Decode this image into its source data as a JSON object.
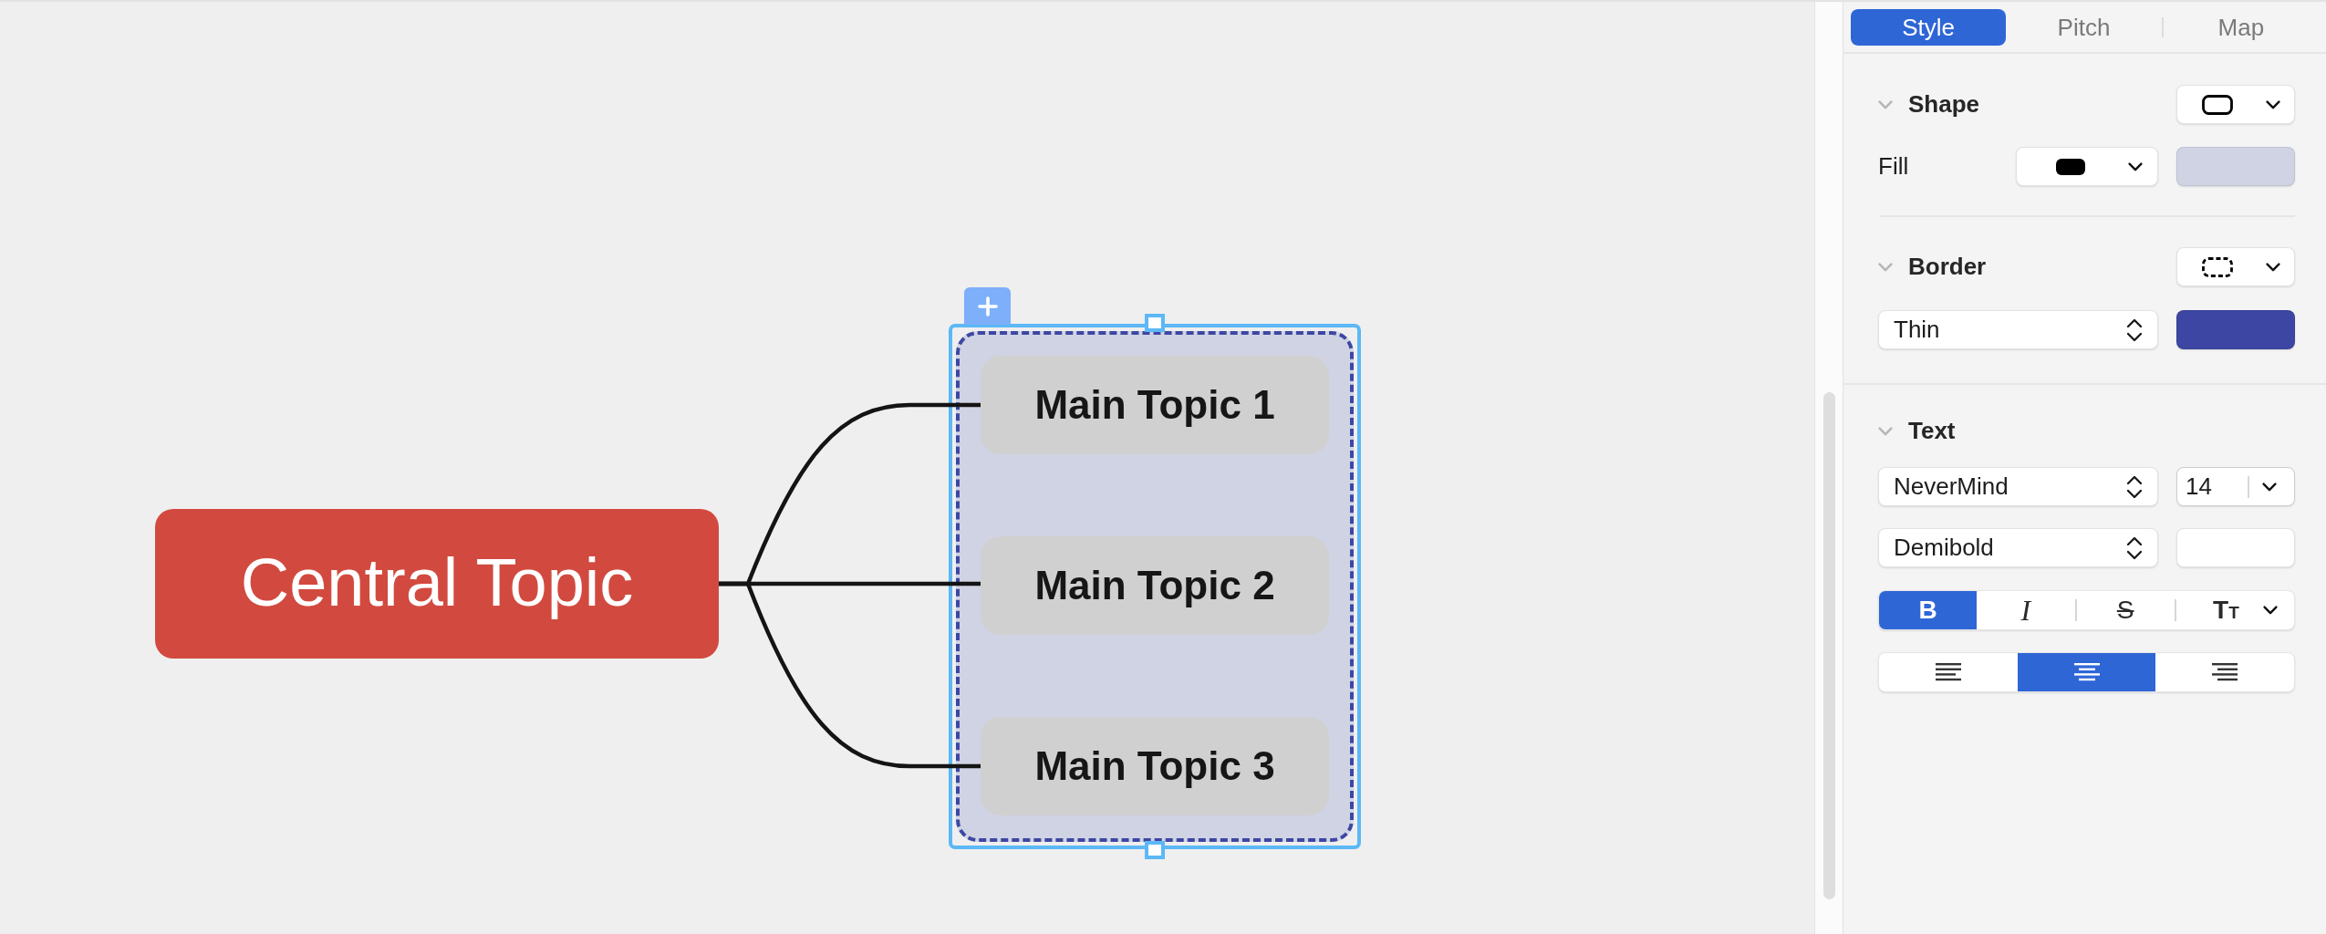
{
  "canvas": {
    "central_topic": "Central Topic",
    "boundary": {
      "selected": true,
      "topics": [
        "Main Topic 1",
        "Main Topic 2",
        "Main Topic 3"
      ]
    }
  },
  "panel": {
    "tabs": [
      {
        "label": "Style",
        "selected": true
      },
      {
        "label": "Pitch",
        "selected": false
      },
      {
        "label": "Map",
        "selected": false
      }
    ],
    "shape": {
      "title": "Shape",
      "expanded": true,
      "fill": {
        "label": "Fill",
        "color": "#d0d3e3"
      }
    },
    "border": {
      "title": "Border",
      "expanded": true,
      "width": "Thin",
      "color": "#3d47a3"
    },
    "text": {
      "title": "Text",
      "expanded": true,
      "font": "NeverMind",
      "size": "14",
      "weight": "Demibold",
      "styles": [
        {
          "kind": "bold",
          "label": "B",
          "selected": true
        },
        {
          "kind": "italic",
          "label": "I",
          "selected": false
        },
        {
          "kind": "strike",
          "label": "S",
          "selected": false
        },
        {
          "kind": "case",
          "label": "TT",
          "selected": false
        }
      ],
      "alignment": [
        {
          "kind": "left",
          "selected": false
        },
        {
          "kind": "center",
          "selected": true
        },
        {
          "kind": "right",
          "selected": false
        }
      ]
    }
  }
}
